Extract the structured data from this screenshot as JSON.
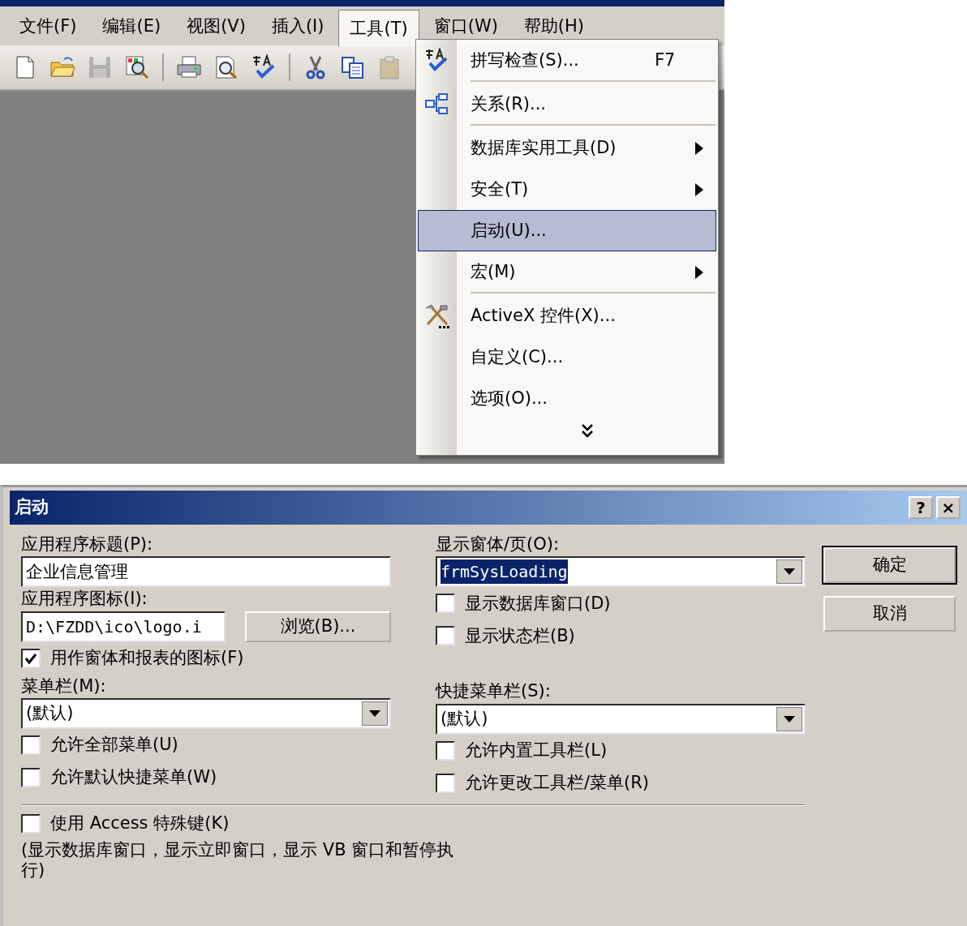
{
  "menubar": {
    "items": [
      {
        "label": "文件(F)",
        "selected": false
      },
      {
        "label": "编辑(E)",
        "selected": false
      },
      {
        "label": "视图(V)",
        "selected": false
      },
      {
        "label": "插入(I)",
        "selected": false
      },
      {
        "label": "工具(T)",
        "selected": true
      },
      {
        "label": "窗口(W)",
        "selected": false
      },
      {
        "label": "帮助(H)",
        "selected": false
      }
    ]
  },
  "toolbar": {
    "buttons": [
      {
        "kind": "new",
        "disabled": false
      },
      {
        "kind": "open",
        "disabled": false
      },
      {
        "kind": "save",
        "disabled": true
      },
      {
        "kind": "search",
        "disabled": false
      },
      {
        "kind": "sep"
      },
      {
        "kind": "print",
        "disabled": false
      },
      {
        "kind": "preview",
        "disabled": false
      },
      {
        "kind": "spell",
        "disabled": false
      },
      {
        "kind": "sep"
      },
      {
        "kind": "cut",
        "disabled": false
      },
      {
        "kind": "copy",
        "disabled": false
      },
      {
        "kind": "paste",
        "disabled": true
      }
    ]
  },
  "tools_menu": {
    "items": [
      {
        "kind": "spell",
        "label": "拼写检查(S)...",
        "shortcut": "F7",
        "submenu": false,
        "selected": false,
        "separator_after": true
      },
      {
        "kind": "relations",
        "label": "关系(R)...",
        "submenu": false,
        "selected": false,
        "separator_after": true
      },
      {
        "kind": "plain",
        "label": "数据库实用工具(D)",
        "submenu": true,
        "selected": false,
        "separator_after": false
      },
      {
        "kind": "plain",
        "label": "安全(T)",
        "submenu": true,
        "selected": false,
        "separator_after": false
      },
      {
        "kind": "plain",
        "label": "启动(U)...",
        "submenu": false,
        "selected": true,
        "separator_after": false
      },
      {
        "kind": "plain",
        "label": "宏(M)",
        "submenu": true,
        "selected": false,
        "separator_after": true
      },
      {
        "kind": "tools",
        "label": "ActiveX 控件(X)...",
        "submenu": false,
        "selected": false,
        "separator_after": false
      },
      {
        "kind": "plain",
        "label": "自定义(C)...",
        "submenu": false,
        "selected": false,
        "separator_after": false
      },
      {
        "kind": "plain",
        "label": "选项(O)...",
        "submenu": false,
        "selected": false,
        "separator_after": false
      }
    ]
  },
  "dialog": {
    "title": "启动",
    "title_buttons": [
      "?",
      "×"
    ],
    "app_title": {
      "label": "应用程序标题(P):",
      "value": "企业信息管理"
    },
    "app_icon": {
      "label": "应用程序图标(I):",
      "value": "D:\\FZDD\\ico\\logo.i",
      "browse_button": "浏览(B)..."
    },
    "use_as_form_icon": {
      "label": "用作窗体和报表的图标(F)",
      "checked": true
    },
    "menu_bar": {
      "label": "菜单栏(M):",
      "value": "(默认)"
    },
    "left_checks": [
      {
        "label": "允许全部菜单(U)",
        "checked": false
      },
      {
        "label": "允许默认快捷菜单(W)",
        "checked": false
      }
    ],
    "display_form": {
      "label": "显示窗体/页(O):",
      "value": "frmSysLoading",
      "highlighted": true
    },
    "right_checks_top": [
      {
        "label": "显示数据库窗口(D)",
        "checked": false
      },
      {
        "label": "显示状态栏(B)",
        "checked": false
      }
    ],
    "shortcut_menu_bar": {
      "label": "快捷菜单栏(S):",
      "value": "(默认)"
    },
    "right_checks": [
      {
        "label": "允许内置工具栏(L)",
        "checked": false
      },
      {
        "label": "允许更改工具栏/菜单(R)",
        "checked": false
      }
    ],
    "special_keys": {
      "label": "使用 Access 特殊键(K)",
      "checked": false
    },
    "note": "(显示数据库窗口，显示立即窗口，显示 VB 窗口和暂停执行)",
    "buttons": [
      {
        "label": "确定",
        "default": true
      },
      {
        "label": "取消",
        "default": false
      }
    ]
  }
}
